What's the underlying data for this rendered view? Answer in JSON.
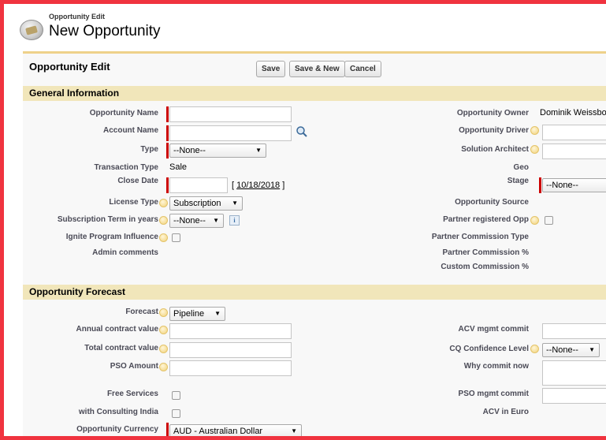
{
  "header": {
    "subtitle": "Opportunity Edit",
    "title": "New Opportunity",
    "icon": "opportunity-crown-icon"
  },
  "toolbar": {
    "title": "Opportunity Edit",
    "save_label": "Save",
    "save_new_label": "Save & New",
    "cancel_label": "Cancel"
  },
  "general": {
    "section_title": "General Information",
    "opportunity_name": {
      "label": "Opportunity Name",
      "value": ""
    },
    "account_name": {
      "label": "Account Name",
      "value": ""
    },
    "type": {
      "label": "Type",
      "value": "--None--"
    },
    "transaction_type": {
      "label": "Transaction Type",
      "value": "Sale"
    },
    "close_date": {
      "label": "Close Date",
      "value": "",
      "today_link": "10/18/2018",
      "open_bracket": "[",
      "close_bracket": "]"
    },
    "license_type": {
      "label": "License Type",
      "value": "Subscription"
    },
    "subscription_term": {
      "label": "Subscription Term in years",
      "value": "--None--"
    },
    "ignite_program": {
      "label": "Ignite Program Influence",
      "checked": false
    },
    "admin_comments": {
      "label": "Admin comments"
    },
    "opportunity_owner": {
      "label": "Opportunity Owner",
      "value": "Dominik Weissboe"
    },
    "opportunity_driver": {
      "label": "Opportunity Driver",
      "value": ""
    },
    "solution_architect": {
      "label": "Solution Architect",
      "value": ""
    },
    "geo": {
      "label": "Geo"
    },
    "stage": {
      "label": "Stage",
      "value": "--None--"
    },
    "opportunity_source": {
      "label": "Opportunity Source"
    },
    "partner_registered": {
      "label": "Partner registered Opp",
      "checked": false
    },
    "partner_commission_type": {
      "label": "Partner Commission Type"
    },
    "partner_commission_pct": {
      "label": "Partner Commission %"
    },
    "custom_commission_pct": {
      "label": "Custom Commission %"
    }
  },
  "forecast": {
    "section_title": "Opportunity Forecast",
    "forecast": {
      "label": "Forecast",
      "value": "Pipeline"
    },
    "annual_contract_value": {
      "label": "Annual contract value",
      "value": ""
    },
    "total_contract_value": {
      "label": "Total contract value",
      "value": ""
    },
    "pso_amount": {
      "label": "PSO Amount",
      "value": ""
    },
    "free_services": {
      "label": "Free Services",
      "checked": false
    },
    "consulting_india": {
      "label": "with Consulting India",
      "checked": false
    },
    "currency": {
      "label": "Opportunity Currency",
      "value": "AUD - Australian Dollar"
    },
    "acv_mgmt_commit": {
      "label": "ACV mgmt commit",
      "value": ""
    },
    "cq_confidence": {
      "label": "CQ Confidence Level",
      "value": "--None--"
    },
    "why_commit_now": {
      "label": "Why commit now",
      "value": ""
    },
    "pso_mgmt_commit": {
      "label": "PSO mgmt commit",
      "value": ""
    },
    "acv_in_euro": {
      "label": "ACV in Euro"
    }
  },
  "colors": {
    "frame": "#f0333f",
    "section_bg": "#f1e6ba",
    "accent_line": "#eed18a",
    "required": "#cc0000"
  }
}
